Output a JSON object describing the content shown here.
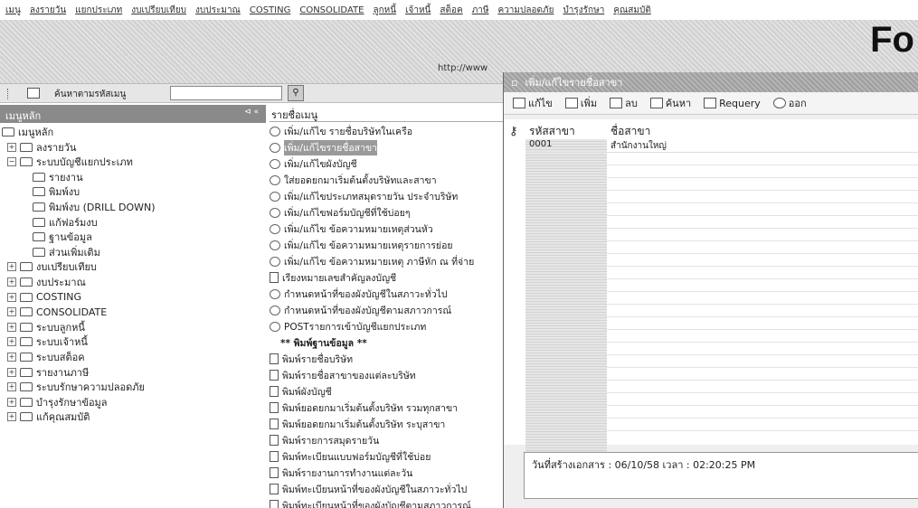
{
  "menubar": [
    "เมนู",
    "ลงรายวัน",
    "แยกประเภท",
    "งบเปรียบเทียบ",
    "งบประมาณ",
    "COSTING",
    "CONSOLIDATE",
    "ลูกหนี้",
    "เจ้าหนี้",
    "สต็อค",
    "ภาษี",
    "ความปลอดภัย",
    "บำรุงรักษา",
    "คุณสมบัติ"
  ],
  "banner": {
    "title": "Fo",
    "url": "http://www"
  },
  "toolbar": {
    "search_label": "ค้นหาตามรหัสเมนู",
    "search_value": ""
  },
  "tree": {
    "header": "เมนูหลัก",
    "header_pin": "⊲ «",
    "items": [
      {
        "label": "เมนูหลัก",
        "level": 0,
        "pm": ""
      },
      {
        "label": "ลงรายวัน",
        "level": 1,
        "pm": "+"
      },
      {
        "label": "ระบบบัญชีแยกประเภท",
        "level": 1,
        "pm": "−"
      },
      {
        "label": "รายงาน",
        "level": 2,
        "pm": ""
      },
      {
        "label": "พิมพ์งบ",
        "level": 2,
        "pm": ""
      },
      {
        "label": "พิมพ์งบ (DRILL DOWN)",
        "level": 2,
        "pm": ""
      },
      {
        "label": "แก้ฟอร์มงบ",
        "level": 2,
        "pm": ""
      },
      {
        "label": "ฐานข้อมูล",
        "level": 2,
        "pm": ""
      },
      {
        "label": "ส่วนเพิ่มเติม",
        "level": 2,
        "pm": ""
      },
      {
        "label": "งบเปรียบเทียบ",
        "level": 1,
        "pm": "+"
      },
      {
        "label": "งบประมาณ",
        "level": 1,
        "pm": "+"
      },
      {
        "label": "COSTING",
        "level": 1,
        "pm": "+"
      },
      {
        "label": "CONSOLIDATE",
        "level": 1,
        "pm": "+"
      },
      {
        "label": "ระบบลูกหนี้",
        "level": 1,
        "pm": "+"
      },
      {
        "label": "ระบบเจ้าหนี้",
        "level": 1,
        "pm": "+"
      },
      {
        "label": "ระบบสต็อค",
        "level": 1,
        "pm": "+"
      },
      {
        "label": "รายงานภาษี",
        "level": 1,
        "pm": "+"
      },
      {
        "label": "ระบบรักษาความปลอดภัย",
        "level": 1,
        "pm": "+"
      },
      {
        "label": "บำรุงรักษาข้อมูล",
        "level": 1,
        "pm": "+"
      },
      {
        "label": "แก้คุณสมบัติ",
        "level": 1,
        "pm": "+"
      }
    ]
  },
  "list": {
    "header": "รายชื่อเมนู",
    "items": [
      {
        "label": "เพิ่ม/แก้ไข รายชื่อบริษัทในเครือ",
        "kind": "circle",
        "selected": false
      },
      {
        "label": "เพิ่ม/แก้ไขรายชื่อสาขา",
        "kind": "circle",
        "selected": true
      },
      {
        "label": "เพิ่ม/แก้ไขผังบัญชี",
        "kind": "circle",
        "selected": false
      },
      {
        "label": "ใส่ยอดยกมาเริ่มต้นตั้งบริษัทและสาขา",
        "kind": "circle",
        "selected": false
      },
      {
        "label": "เพิ่ม/แก้ไขประเภทสมุดรายวัน ประจำบริษัท",
        "kind": "circle",
        "selected": false
      },
      {
        "label": "เพิ่ม/แก้ไขฟอร์มบัญชีที่ใช้บ่อยๆ",
        "kind": "circle",
        "selected": false
      },
      {
        "label": "เพิ่ม/แก้ไข ข้อความหมายเหตุส่วนหัว",
        "kind": "circle",
        "selected": false
      },
      {
        "label": "เพิ่ม/แก้ไข ข้อความหมายเหตุรายการย่อย",
        "kind": "circle",
        "selected": false
      },
      {
        "label": "เพิ่ม/แก้ไข ข้อความหมายเหตุ ภาษีหัก ณ ที่จ่าย",
        "kind": "circle",
        "selected": false
      },
      {
        "label": "เรียงหมายเลขสำคัญลงบัญชี",
        "kind": "doc",
        "selected": false
      },
      {
        "label": "กำหนดหน้าที่ของผังบัญชีในสภาวะทั่วไป",
        "kind": "circle",
        "selected": false
      },
      {
        "label": "กำหนดหน้าที่ของผังบัญชีตามสภาวการณ์",
        "kind": "circle",
        "selected": false
      },
      {
        "label": "POSTรายการเข้าบัญชีแยกประเภท",
        "kind": "circle",
        "selected": false
      },
      {
        "label": "** พิมพ์ฐานข้อมูล **",
        "kind": "bold",
        "selected": false
      },
      {
        "label": "พิมพ์รายชื่อบริษัท",
        "kind": "doc",
        "selected": false
      },
      {
        "label": "พิมพ์รายชื่อสาขาของแต่ละบริษัท",
        "kind": "doc",
        "selected": false
      },
      {
        "label": "พิมพ์ผังบัญชี",
        "kind": "doc",
        "selected": false
      },
      {
        "label": "พิมพ์ยอดยกมาเริ่มต้นตั้งบริษัท รวมทุกสาขา",
        "kind": "doc",
        "selected": false
      },
      {
        "label": "พิมพ์ยอดยกมาเริ่มต้นตั้งบริษัท ระบุสาขา",
        "kind": "doc",
        "selected": false
      },
      {
        "label": "พิมพ์รายการสมุดรายวัน",
        "kind": "doc",
        "selected": false
      },
      {
        "label": "พิมพ์ทะเบียนแบบฟอร์มบัญชีที่ใช้บ่อย",
        "kind": "doc",
        "selected": false
      },
      {
        "label": "พิมพ์รายงานการทำงานแต่ละวัน",
        "kind": "doc",
        "selected": false
      },
      {
        "label": "พิมพ์ทะเบียนหน้าที่ของผังบัญชีในสภาวะทั่วไป",
        "kind": "doc",
        "selected": false
      },
      {
        "label": "พิมพ์ทะเบียนหน้าที่ของผังบัญชีตามสภาวการณ์",
        "kind": "doc",
        "selected": false
      }
    ]
  },
  "window": {
    "title": "เพิ่ม/แก้ไขรายชื่อสาขา",
    "toolbar": [
      "แก้ไข",
      "เพิ่ม",
      "ลบ",
      "ค้นหา",
      "Requery",
      "ออก"
    ],
    "columns": [
      "รหัสสาขา",
      "ชื่อสาขา"
    ],
    "rows": [
      [
        "0001",
        "สำนักงานใหญ่"
      ]
    ],
    "footer": "วันที่สร้างเอกสาร : 06/10/58 เวลา : 02:20:25 PM"
  }
}
